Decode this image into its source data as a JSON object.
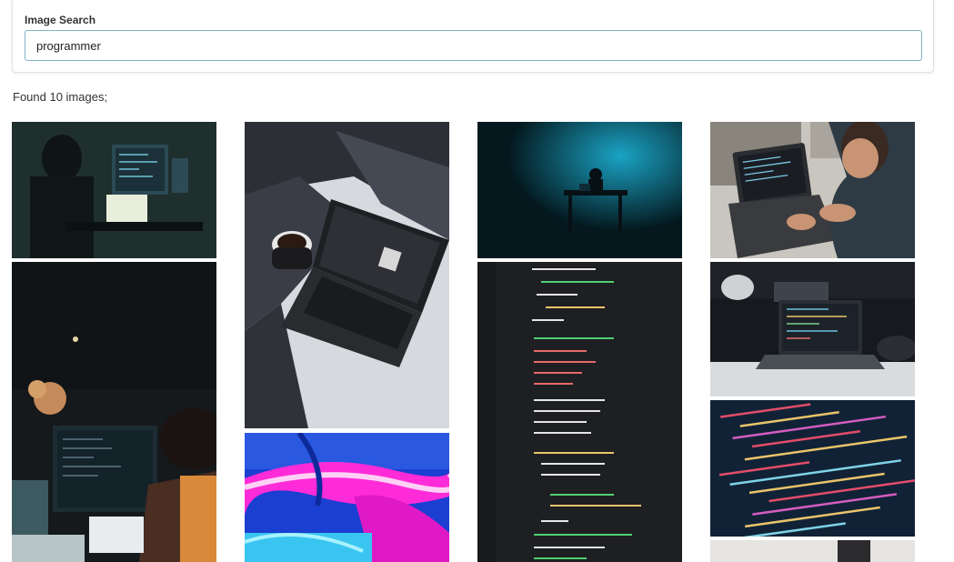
{
  "search": {
    "label": "Image Search",
    "value": "programmer"
  },
  "results": {
    "status_text": "Found 10 images;"
  },
  "gallery": {
    "images": [
      {
        "subject": "programmer with headset at dark multi-monitor desk"
      },
      {
        "subject": "programmer at night office with monitor"
      },
      {
        "subject": "laptop on bed with coffee cup"
      },
      {
        "subject": "abstract neon pink and blue light trails"
      },
      {
        "subject": "silhouette at desk in teal-lit room"
      },
      {
        "subject": "code on screen close-up"
      },
      {
        "subject": "man typing on laptop with code"
      },
      {
        "subject": "laptop with code on desk, dark room"
      },
      {
        "subject": "colorful HTML code close-up"
      },
      {
        "subject": "partial image at bottom"
      }
    ]
  }
}
